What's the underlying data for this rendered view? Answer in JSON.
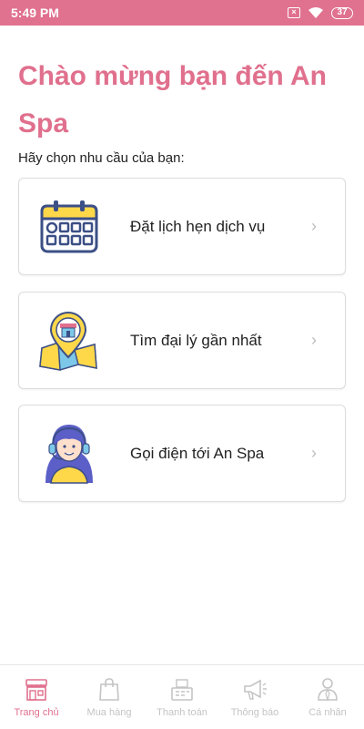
{
  "status_bar": {
    "time": "5:49 PM",
    "battery": "37"
  },
  "header": {
    "title": "Chào mừng bạn đến An Spa",
    "subtitle": "Hãy chọn nhu cầu của bạn:"
  },
  "options": [
    {
      "label": "Đặt lịch hẹn dịch vụ",
      "icon": "calendar-icon"
    },
    {
      "label": "Tìm đại lý gần nhất",
      "icon": "map-store-icon"
    },
    {
      "label": "Gọi điện tới An Spa",
      "icon": "support-agent-icon"
    }
  ],
  "chevron": "›",
  "bottom_nav": [
    {
      "label": "Trang chủ",
      "icon": "home-store-icon",
      "active": true
    },
    {
      "label": "Mua hàng",
      "icon": "shopping-bag-icon",
      "active": false
    },
    {
      "label": "Thanh toán",
      "icon": "register-icon",
      "active": false
    },
    {
      "label": "Thông báo",
      "icon": "megaphone-icon",
      "active": false
    },
    {
      "label": "Cá nhân",
      "icon": "person-icon",
      "active": false
    }
  ],
  "colors": {
    "accent": "#e0708d",
    "inactive": "#c4c4c4"
  }
}
